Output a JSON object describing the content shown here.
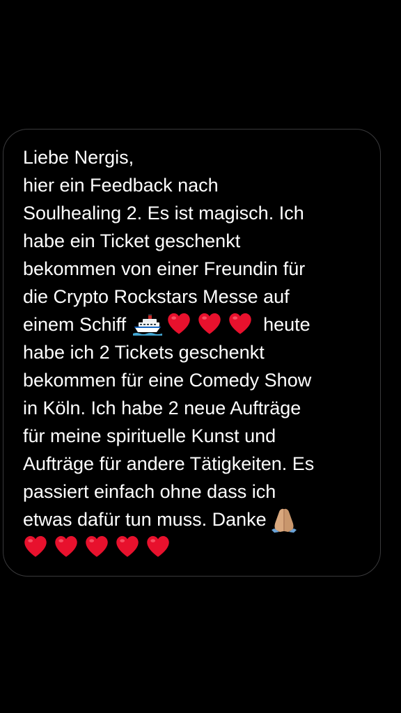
{
  "message": {
    "line_1": "Liebe Nergis,",
    "line_2": "hier ein Feedback nach",
    "line_3": "Soulhealing 2. Es ist magisch. Ich",
    "line_4": "habe ein Ticket geschenkt",
    "line_5": "bekommen von einer Freundin für",
    "line_6": "die Crypto Rockstars Messe auf",
    "line_7_before_icons": "einem Schiff",
    "line_7_after_icons": "heute",
    "line_8": "habe ich 2 Tickets geschenkt",
    "line_9": "bekommen für eine Comedy Show",
    "line_10": "in Köln. Ich habe 2 neue Aufträge",
    "line_11": "für meine spirituelle Kunst und",
    "line_12": "Aufträge für andere Tätigkeiten. Es",
    "line_13": "passiert einfach ohne dass ich",
    "line_14": "etwas dafür tun muss. Danke"
  },
  "icons": {
    "line_7": [
      "ship-emoji",
      "red-heart-emoji",
      "red-heart-emoji",
      "red-heart-emoji"
    ],
    "line_14": [
      "folded-hands-emoji"
    ],
    "line_15": [
      "red-heart-emoji",
      "red-heart-emoji",
      "red-heart-emoji",
      "red-heart-emoji",
      "red-heart-emoji"
    ]
  },
  "colors": {
    "background": "#000000",
    "bubble_border": "#3a3a3c",
    "text": "#ffffff",
    "heart": "#e8112d",
    "hands_skin": "#d9a87e"
  }
}
